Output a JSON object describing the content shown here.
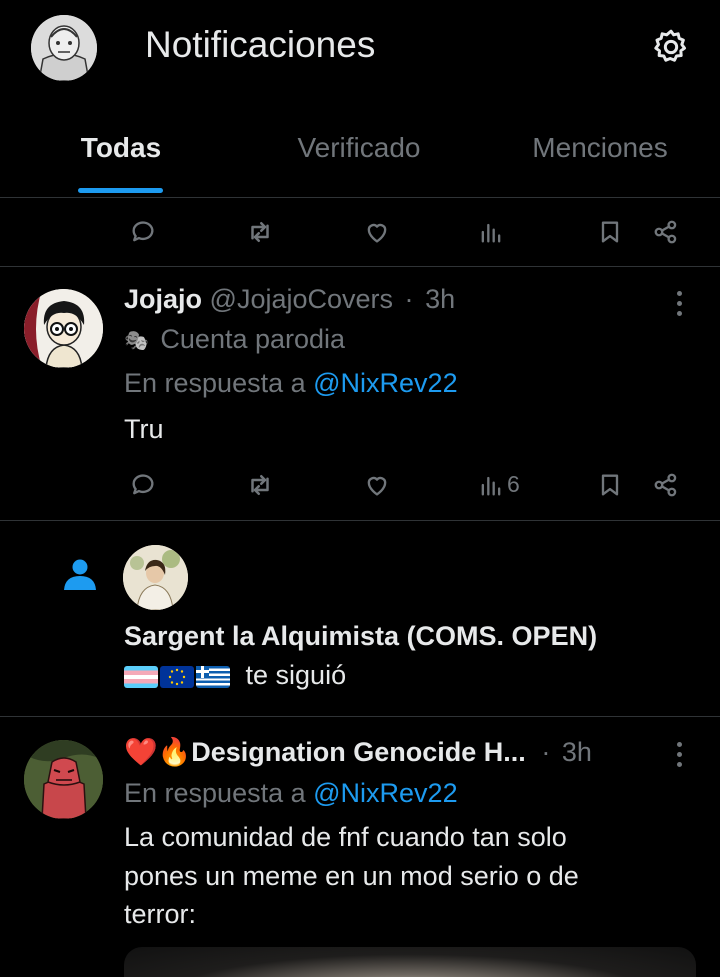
{
  "header": {
    "title": "Notificaciones"
  },
  "tabs": [
    {
      "label": "Todas",
      "active": true
    },
    {
      "label": "Verificado",
      "active": false
    },
    {
      "label": "Menciones",
      "active": false
    }
  ],
  "colors": {
    "accent": "#1d9bf0",
    "background": "#000000",
    "muted": "#71767b",
    "divider": "#2f3336",
    "follow_icon": "#1d9bf0"
  },
  "tweet_action_icons": [
    "reply-icon",
    "retweet-icon",
    "like-icon",
    "views-icon",
    "bookmark-icon",
    "share-icon"
  ],
  "notifications": [
    {
      "type": "tweet",
      "author_name": "Jojajo",
      "author_handle": "@JojajoCovers",
      "separator": "·",
      "time": "3h",
      "badge_emoji": "🎭",
      "badge_text": "Cuenta parodia",
      "reply_prefix": "En respuesta a",
      "reply_to": "@NixRev22",
      "text": "Tru",
      "views": "6"
    },
    {
      "type": "follow",
      "user_name": "Sargent la Alquimista (COMS. OPEN)",
      "action_text": "te siguió",
      "flags": [
        "trans-flag",
        "eu-flag",
        "greece-flag"
      ]
    },
    {
      "type": "tweet",
      "author_name": "❤️🔥Designation Genocide H...",
      "separator": "·",
      "time": "3h",
      "reply_prefix": "En respuesta a",
      "reply_to": "@NixRev22",
      "text_lines": [
        "La comunidad de fnf cuando tan solo",
        "pones un meme en un mod serio o de",
        "terror:"
      ]
    }
  ]
}
